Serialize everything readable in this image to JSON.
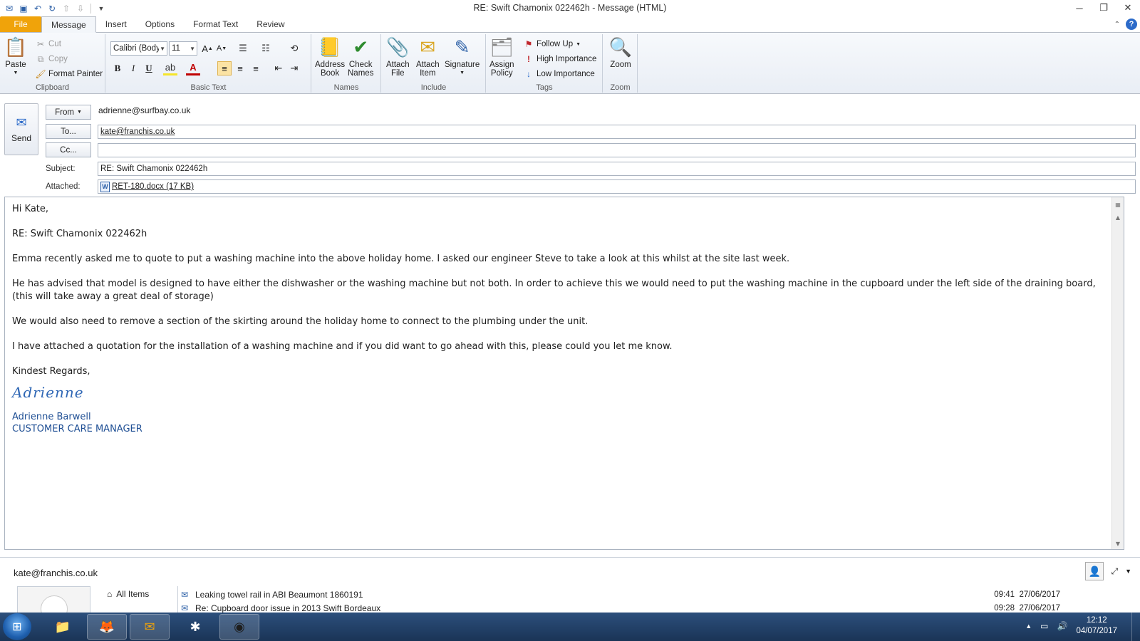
{
  "window": {
    "title": "RE: Swift Chamonix 022462h  -  Message (HTML)"
  },
  "ribbon": {
    "tabs": [
      {
        "label": "File"
      },
      {
        "label": "Message"
      },
      {
        "label": "Insert"
      },
      {
        "label": "Options"
      },
      {
        "label": "Format Text"
      },
      {
        "label": "Review"
      }
    ],
    "clipboard": {
      "paste": "Paste",
      "cut": "Cut",
      "copy": "Copy",
      "format_painter": "Format Painter",
      "group": "Clipboard"
    },
    "basic_text": {
      "font_name": "Calibri (Body)",
      "font_size": "11",
      "bold": "B",
      "italic": "I",
      "underline": "U",
      "group": "Basic Text"
    },
    "names": {
      "address_book_1": "Address",
      "address_book_2": "Book",
      "check_names_1": "Check",
      "check_names_2": "Names",
      "group": "Names"
    },
    "include": {
      "attach_file_1": "Attach",
      "attach_file_2": "File",
      "attach_item_1": "Attach",
      "attach_item_2": "Item",
      "signature": "Signature",
      "group": "Include"
    },
    "tags": {
      "assign_policy_1": "Assign",
      "assign_policy_2": "Policy",
      "follow_up": "Follow Up",
      "high_importance": "High Importance",
      "low_importance": "Low Importance",
      "group": "Tags"
    },
    "zoom": {
      "zoom": "Zoom",
      "group": "Zoom"
    }
  },
  "header": {
    "send": "Send",
    "from_button": "From",
    "from_value": "adrienne@surfbay.co.uk",
    "to_button": "To...",
    "to_value": "kate@franchis.co.uk",
    "cc_button": "Cc...",
    "cc_value": "",
    "subject_label": "Subject:",
    "subject_value": "RE: Swift Chamonix 022462h",
    "attached_label": "Attached:",
    "attachment": "RET-180.docx (17 KB)"
  },
  "body": {
    "greeting": "Hi Kate,",
    "ref": "RE: Swift Chamonix 022462h",
    "p1": "Emma recently asked me to quote to put a washing machine into the above holiday home.  I asked our engineer Steve to take a look at this whilst at the site last week.",
    "p2": "He has advised that model is designed to have either the dishwasher or the washing machine but not both.  In order to achieve this we would need to put the washing machine in the cupboard under the left side of the draining board, (this will take away a great deal of storage)",
    "p3": "We would also need to remove a section of the skirting around the holiday home to connect to the plumbing under the unit.",
    "p4": "I have attached a quotation for the installation of a washing machine and if you did want to go ahead with this, please could you let me know.",
    "closing": "Kindest Regards,",
    "signature_script": "Adrienne",
    "sig_name": "Adrienne Barwell",
    "sig_title": "CUSTOMER CARE MANAGER"
  },
  "people_pane": {
    "contact": "kate@franchis.co.uk",
    "nav_all_items": "All Items",
    "items": [
      {
        "subject": "Leaking towel rail in ABI Beaumont 1860191",
        "time": "09:41",
        "date": "27/06/2017"
      },
      {
        "subject": "Re: Cupboard door issue in 2013 Swift Bordeaux",
        "time": "09:28",
        "date": "27/06/2017"
      }
    ]
  },
  "taskbar": {
    "time": "12:12",
    "date": "04/07/2017"
  }
}
